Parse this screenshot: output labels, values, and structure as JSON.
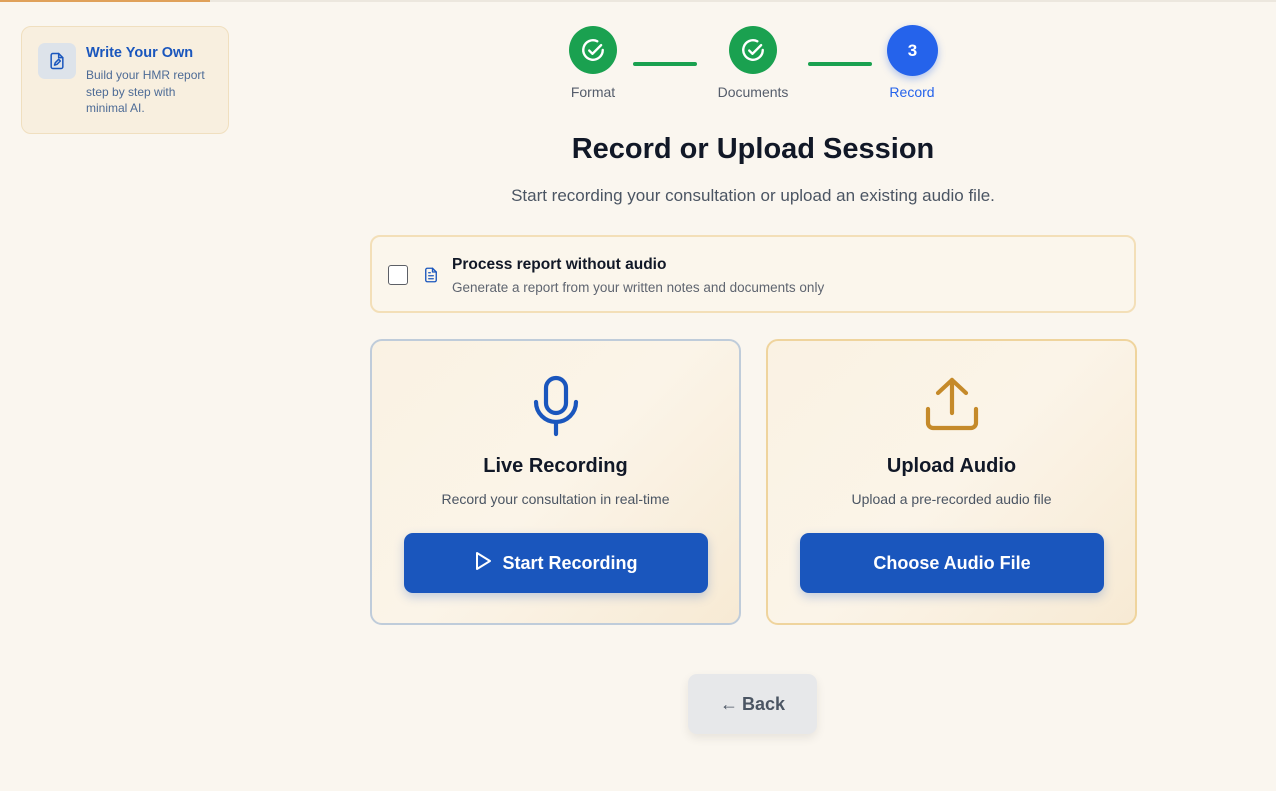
{
  "sidebar": {
    "card_title": "Write Your Own",
    "card_description": "Build your HMR report step by step with minimal AI.",
    "card_icon": "document-edit-icon"
  },
  "stepper": {
    "steps": [
      {
        "label": "Format",
        "status": "complete",
        "icon": "check-circle-icon"
      },
      {
        "label": "Documents",
        "status": "complete",
        "icon": "check-circle-icon"
      },
      {
        "label": "Record",
        "status": "active",
        "number": "3"
      }
    ]
  },
  "main": {
    "title": "Record or Upload Session",
    "subtitle": "Start recording your consultation or upload an existing audio file."
  },
  "no_audio_option": {
    "checked": false,
    "title": "Process report without audio",
    "description": "Generate a report from your written notes and documents only",
    "icon": "document-icon"
  },
  "live_recording": {
    "icon": "microphone-icon",
    "title": "Live Recording",
    "description": "Record your consultation in real-time",
    "button_label": "Start Recording",
    "button_icon": "play-icon"
  },
  "upload_audio": {
    "icon": "upload-icon",
    "title": "Upload Audio",
    "description": "Upload a pre-recorded audio file",
    "button_label": "Choose Audio File"
  },
  "navigation": {
    "back_arrow": "←",
    "back_label": "Back"
  },
  "colors": {
    "background": "#faf6ef",
    "primary_blue": "#1a56bd",
    "active_step_blue": "#2563eb",
    "success_green": "#1aa150",
    "upload_icon_gold": "#c58a2a"
  }
}
